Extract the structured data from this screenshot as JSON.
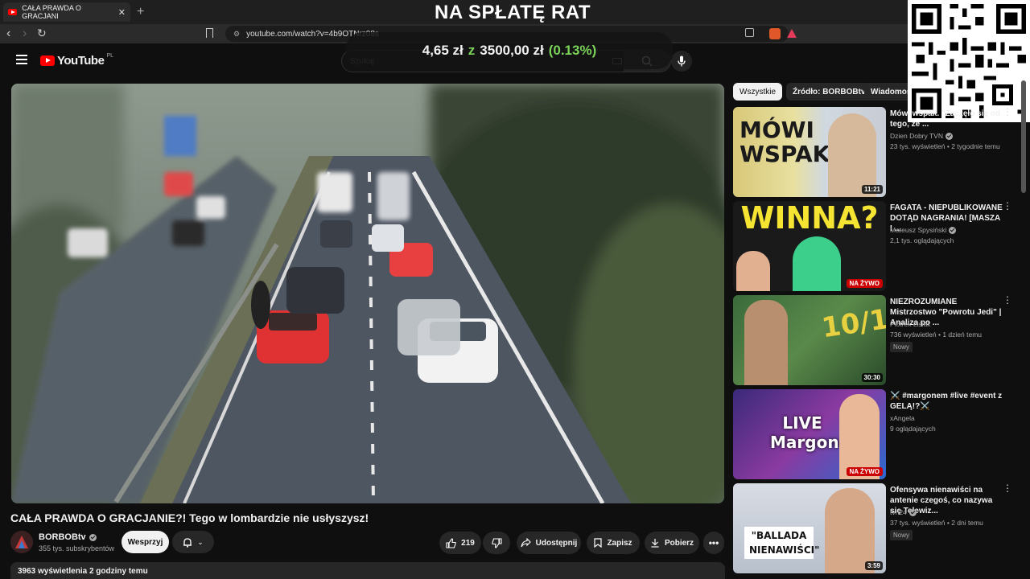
{
  "browser": {
    "tab_title": "CAŁA PRAWDA O GRACJANIE?! Tego w lombardzie nie usłyszysz!",
    "tab_title_short": "CAŁA PRAWDA O GRACJANI",
    "url": "youtube.com/watch?v=4b9OTNrz08s"
  },
  "overlay": {
    "title": "NA SPŁATĘ RAT",
    "amount": "4,65 zł",
    "sep": "z",
    "goal": "3500,00 zł",
    "percent": "(0.13%)"
  },
  "header": {
    "logo_text": "YouTube",
    "region": "PL",
    "search_placeholder": "Szukaj"
  },
  "video": {
    "title": "CAŁA PRAWDA O GRACJANIE?! Tego w lombardzie nie usłyszysz!",
    "channel": "BORBOBtv",
    "subscribers": "355 tys. subskrybentów",
    "join_label": "Wesprzyj",
    "likes": "219",
    "share_label": "Udostępnij",
    "save_label": "Zapisz",
    "download_label": "Pobierz",
    "views_line": "3963 wyświetlenia  2 godziny temu"
  },
  "chips": [
    "Wszystkie",
    "Źródło: BORBOBtv",
    "Wiadomości"
  ],
  "related": [
    {
      "title": "Mówi wspak. \"Zaczęło się od tego, że ...",
      "channel": "Dzien Dobry TVN",
      "meta": "23 tys. wyświetleń • 2 tygodnie temu",
      "duration": "11:21",
      "thumb_text": "MÓWI WSPAK"
    },
    {
      "title": "FAGATA - NIEPUBLIKOWANE DOTĄD NAGRANIA! [MASZA I ...",
      "channel": "Mateusz Spysiński",
      "meta": "2,1 tys. oglądających",
      "live": "NA ŻYWO",
      "thumb_text": "WINNA?"
    },
    {
      "title": "NIEZROZUMIANE Mistrzostwo \"Powrotu Jedi\" | Analiza po ...",
      "channel": "Piotrek Lisiak",
      "meta": "736 wyświetleń • 1 dzień temu",
      "badge": "Nowy",
      "duration": "30:30",
      "thumb_text": "10/10"
    },
    {
      "title": "⚔️ #margonem #live #event z GELĄ!?⚔️",
      "channel": "xAngela",
      "meta": "9 oglądających",
      "live": "NA ŻYWO",
      "thumb_text": "LIVE Margonem"
    },
    {
      "title": "Ofensywa nienawiści na antenie czegoś, co nazywa się Telewiz...",
      "channel": "tvn24",
      "meta": "37 tys. wyświetleń • 2 dni temu",
      "badge": "Nowy",
      "duration": "3:59",
      "thumb_text": "\"BALLADA NIENAWIŚCI\""
    }
  ]
}
